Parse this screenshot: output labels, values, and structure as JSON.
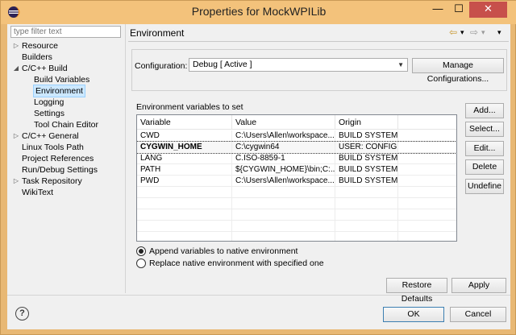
{
  "window": {
    "title": "Properties for MockWPILib",
    "minimize": "—",
    "maximize": "☐",
    "close": "✕"
  },
  "filter": {
    "placeholder": "type filter text"
  },
  "tree": [
    {
      "label": "Resource",
      "arrow": "▷",
      "indent": 0
    },
    {
      "label": "Builders",
      "arrow": "",
      "indent": 0
    },
    {
      "label": "C/C++ Build",
      "arrow": "◢",
      "indent": 0
    },
    {
      "label": "Build Variables",
      "arrow": "",
      "indent": 1
    },
    {
      "label": "Environment",
      "arrow": "",
      "indent": 1,
      "selected": true
    },
    {
      "label": "Logging",
      "arrow": "",
      "indent": 1
    },
    {
      "label": "Settings",
      "arrow": "",
      "indent": 1
    },
    {
      "label": "Tool Chain Editor",
      "arrow": "",
      "indent": 1
    },
    {
      "label": "C/C++ General",
      "arrow": "▷",
      "indent": 0
    },
    {
      "label": "Linux Tools Path",
      "arrow": "",
      "indent": 0
    },
    {
      "label": "Project References",
      "arrow": "",
      "indent": 0
    },
    {
      "label": "Run/Debug Settings",
      "arrow": "",
      "indent": 0
    },
    {
      "label": "Task Repository",
      "arrow": "▷",
      "indent": 0
    },
    {
      "label": "WikiText",
      "arrow": "",
      "indent": 0
    }
  ],
  "page": {
    "title": "Environment",
    "nav_back": "⇦",
    "nav_back_menu": "▾",
    "nav_forward": "⇨",
    "nav_forward_menu": "▾",
    "nav_menu": "▾"
  },
  "configuration": {
    "label": "Configuration:",
    "value": "Debug  [ Active ]",
    "manage_label": "Manage Configurations..."
  },
  "env": {
    "section_label": "Environment variables to set",
    "columns": [
      "Variable",
      "Value",
      "Origin"
    ],
    "rows": [
      {
        "variable": "CWD",
        "value": "C:\\Users\\Allen\\workspace...",
        "origin": "BUILD SYSTEM"
      },
      {
        "variable": "CYGWIN_HOME",
        "value": "C:\\cygwin64",
        "origin": "USER: CONFIG",
        "selected": true
      },
      {
        "variable": "LANG",
        "value": "C.ISO-8859-1",
        "origin": "BUILD SYSTEM"
      },
      {
        "variable": "PATH",
        "value": "${CYGWIN_HOME}\\bin;C:...",
        "origin": "BUILD SYSTEM"
      },
      {
        "variable": "PWD",
        "value": "C:\\Users\\Allen\\workspace...",
        "origin": "BUILD SYSTEM"
      }
    ],
    "buttons": {
      "add": "Add...",
      "select": "Select...",
      "edit": "Edit...",
      "delete": "Delete",
      "undefine": "Undefine"
    },
    "append_label": "Append variables to native environment",
    "replace_label": "Replace native environment with specified one",
    "append_selected": true
  },
  "footer": {
    "restore_defaults": "Restore Defaults",
    "apply": "Apply",
    "ok": "OK",
    "cancel": "Cancel",
    "help": "?"
  },
  "colors": {
    "titlebar": "#f3c27b",
    "close_button": "#c7504b",
    "selection": "#cce8ff"
  }
}
